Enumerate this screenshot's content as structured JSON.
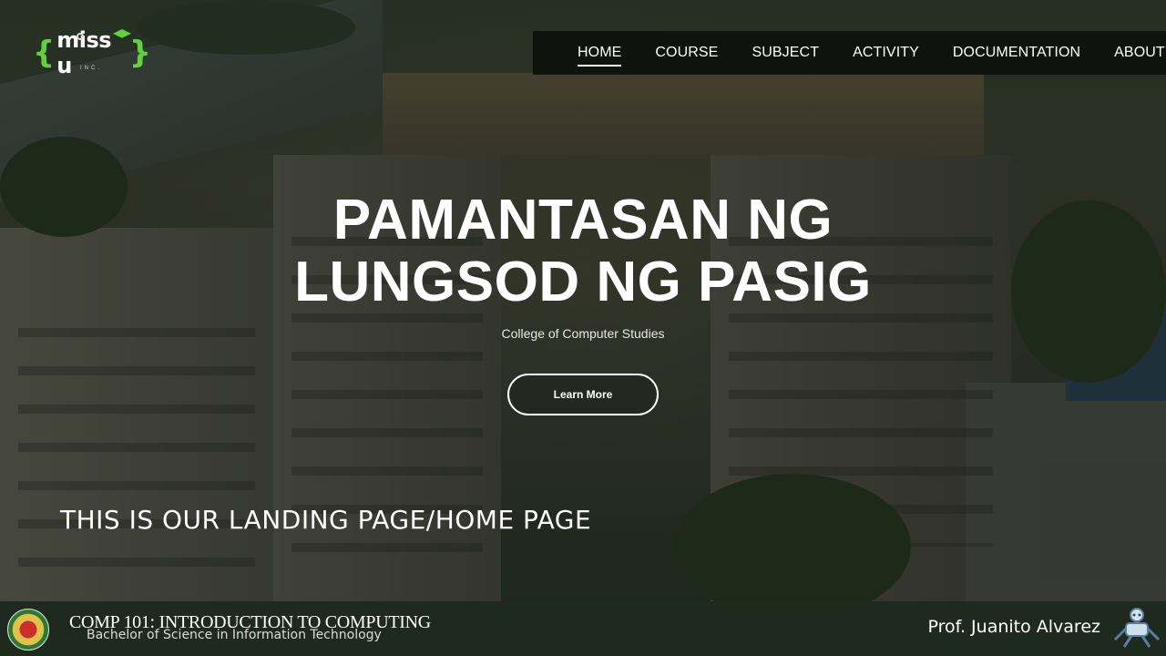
{
  "logo": {
    "text": "miss u",
    "sub": "INC."
  },
  "nav": {
    "items": [
      {
        "label": "HOME",
        "active": true
      },
      {
        "label": "COURSE",
        "active": false
      },
      {
        "label": "SUBJECT",
        "active": false
      },
      {
        "label": "ACTIVITY",
        "active": false
      },
      {
        "label": "DOCUMENTATION",
        "active": false
      },
      {
        "label": "ABOUT",
        "active": false
      }
    ]
  },
  "hero": {
    "title_line1": "PAMANTASAN NG",
    "title_line2": "LUNGSOD NG PASIG",
    "subtitle": "College of Computer Studies",
    "button_label": "Learn More"
  },
  "caption": "THIS IS OUR LANDING PAGE/HOME PAGE",
  "footer": {
    "course_title": "COMP 101: INTRODUCTION TO COMPUTING",
    "course_sub": "Bachelor of Science in Information Technology",
    "professor": "Prof. Juanito  Alvarez"
  },
  "colors": {
    "accent": "#63d13e",
    "footer_bg": "#1e2a1e",
    "nav_bg": "#080e08"
  }
}
